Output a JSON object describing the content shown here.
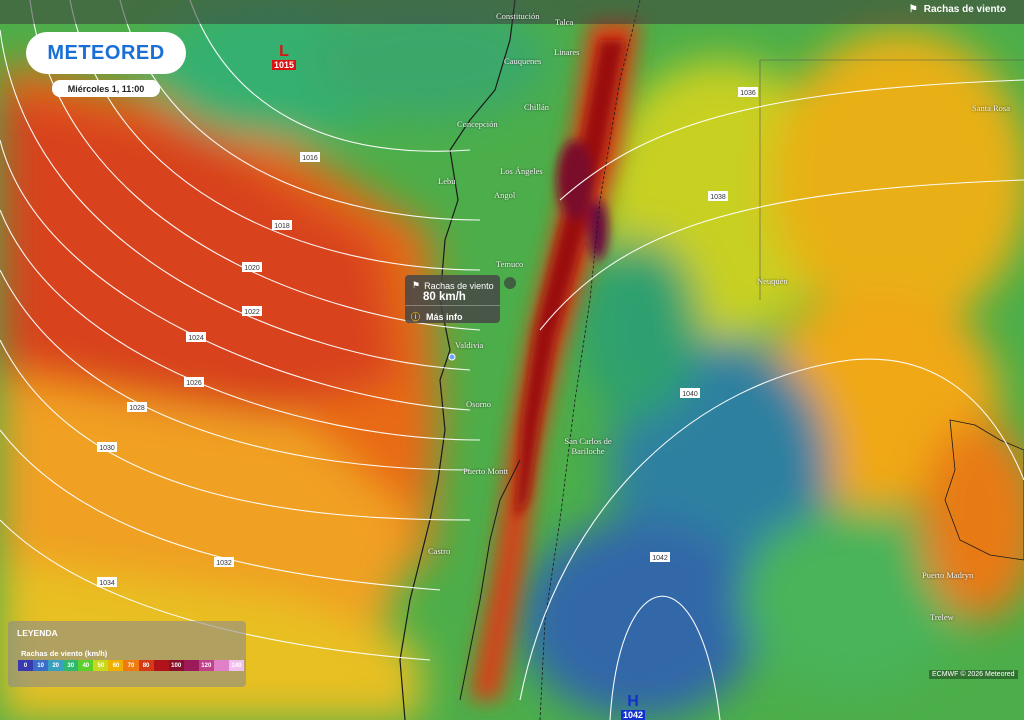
{
  "brand": {
    "logo_text": "METEORED",
    "date_label": "Miércoles 1, 11:00"
  },
  "layer": {
    "title": "Rachas de viento",
    "icon": "flag-icon"
  },
  "pressure_centers": [
    {
      "letter": "L",
      "value": "1015",
      "color": "#d11"
    },
    {
      "letter": "H",
      "value": "1042",
      "color": "#13c"
    }
  ],
  "isobar_labels": [
    "1016",
    "1018",
    "1020",
    "1022",
    "1024",
    "1026",
    "1028",
    "1030",
    "1032",
    "1034",
    "1036",
    "1038",
    "1040",
    "1042"
  ],
  "places": [
    "Constitución",
    "Talca",
    "Linares",
    "Cauquenes",
    "Chillán",
    "Concepción",
    "Los Ángeles",
    "Lebu",
    "Angol",
    "Temuco",
    "Valdivia",
    "Osorno",
    "Puerto Montt",
    "Castro",
    "San Carlos de Bariloche",
    "Neuquén",
    "Santa Rosa",
    "Puerto Madryn",
    "Trelew"
  ],
  "tooltip": {
    "title": "Rachas de viento",
    "value": "80 km/h",
    "more": "Más info"
  },
  "legend": {
    "title": "LEYENDA",
    "subtitle": "Rachas de viento (km/h)",
    "stops": [
      {
        "label": "0",
        "color": "#3a3ab0"
      },
      {
        "label": "10",
        "color": "#3a6ec8"
      },
      {
        "label": "20",
        "color": "#3aa0c0"
      },
      {
        "label": "30",
        "color": "#2fb86e"
      },
      {
        "label": "40",
        "color": "#5bd02a"
      },
      {
        "label": "50",
        "color": "#c8d81c"
      },
      {
        "label": "60",
        "color": "#f0b000"
      },
      {
        "label": "70",
        "color": "#ee7a10"
      },
      {
        "label": "80",
        "color": "#d63a14"
      },
      {
        "label": "",
        "color": "#b0141a"
      },
      {
        "label": "100",
        "color": "#8a0f2a"
      },
      {
        "label": "",
        "color": "#9c1a5a"
      },
      {
        "label": "120",
        "color": "#c0408a"
      },
      {
        "label": "",
        "color": "#e080c8"
      },
      {
        "label": "140",
        "color": "#f0c0ec"
      }
    ]
  },
  "copyright": "ECMWF © 2026 Meteored"
}
